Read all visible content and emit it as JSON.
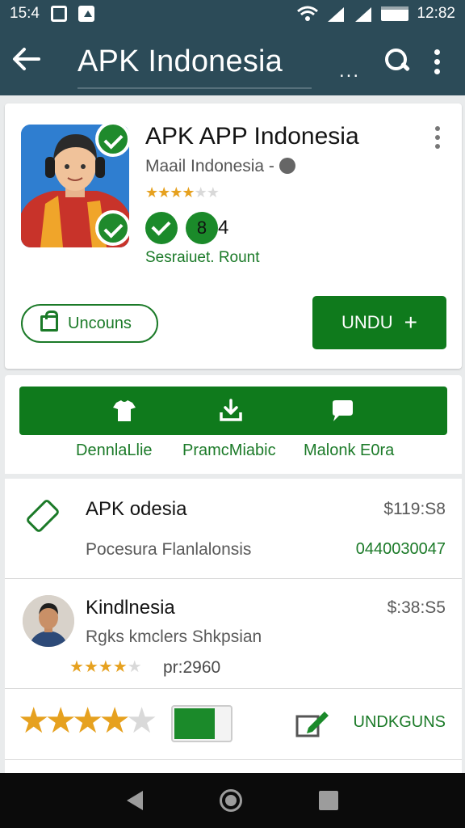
{
  "status_bar": {
    "time_left": "15:4",
    "time_right": "12:82"
  },
  "app_bar": {
    "title": "APK Indonesia",
    "overflow_dots": "..."
  },
  "app": {
    "name": "APK  APP Indonesia",
    "developer": "Maail Indonesia -",
    "rating": 3.5,
    "stars_text": "★★★★★",
    "badge_number": "8",
    "badge_suffix": "4",
    "caption": "Sesraiuet. Rount",
    "secondary_button": "Uncouns",
    "install_button": "UNDU",
    "install_plus": "+"
  },
  "actions": [
    {
      "label": "DennlaLlie",
      "icon": "shirt-icon"
    },
    {
      "label": "PramcMiabic",
      "icon": "download-icon"
    },
    {
      "label": "Malonk E0ra",
      "icon": "chat-bubble-icon"
    }
  ],
  "list": {
    "rows": [
      {
        "title": "APK odesia",
        "subtitle": "Pocesura  Flanlalonsis",
        "price": "$119:S8",
        "green_value": "0440030047"
      },
      {
        "title": "Kindlnesia",
        "subtitle": "Rgks kmclers Shkpsian",
        "price": "$:38:S5",
        "rating_text": "pr:2960"
      },
      {
        "action_label": "UNDKGUNS"
      }
    ]
  },
  "colors": {
    "primary_dark": "#2c4b58",
    "accent_green": "#0f7a1c",
    "star": "#e6a11f"
  }
}
